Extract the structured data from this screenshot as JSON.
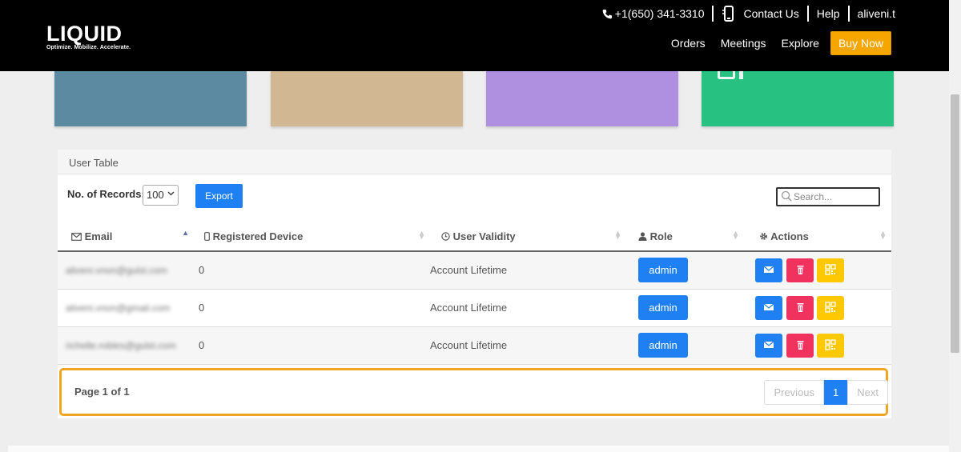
{
  "header": {
    "logo_text": "LIQUID",
    "logo_tagline": "Optimize. Mobilize. Accelerate.",
    "phone": "+1(650) 341-3310",
    "contact": "Contact Us",
    "help": "Help",
    "user": "aliveni.t",
    "nav": [
      "Orders",
      "Meetings",
      "Explore"
    ],
    "buy_now": "Buy Now"
  },
  "colors": {
    "card1": "#5c8ba1",
    "card2": "#d1b893",
    "card3": "#ae8fe0",
    "card4": "#27c281",
    "primary": "#1e80f2",
    "danger": "#f0325f",
    "warning": "#ffc800",
    "accent": "#f7a600"
  },
  "table": {
    "title": "User Table",
    "records_label": "No. of Records:",
    "records_value": "100",
    "export_label": "Export",
    "search_placeholder": "Search...",
    "columns": [
      "Email",
      "Registered Device",
      "User Validity",
      "Role",
      "Actions"
    ],
    "rows": [
      {
        "email": "aliveni.vnon@gulst.com",
        "device": "0",
        "validity": "Account Lifetime",
        "role": "admin"
      },
      {
        "email": "aliveni.vnon@gmail.com",
        "device": "0",
        "validity": "Account Lifetime",
        "role": "admin"
      },
      {
        "email": "richelle.robles@gulst.com",
        "device": "0",
        "validity": "Account Lifetime",
        "role": "admin"
      }
    ],
    "page_info": "Page 1 of 1",
    "pager": {
      "previous": "Previous",
      "current": "1",
      "next": "Next"
    }
  }
}
